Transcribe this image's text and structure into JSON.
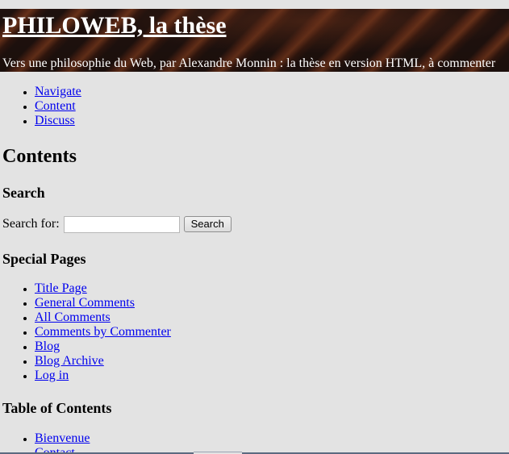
{
  "header": {
    "title": "PHILOWEB, la thèse",
    "tagline": "Vers une philosophie du Web, par Alexandre Monnin : la thèse en version HTML, à commenter"
  },
  "nav": {
    "items": [
      {
        "label": "Navigate"
      },
      {
        "label": "Content"
      },
      {
        "label": "Discuss"
      }
    ]
  },
  "main": {
    "heading": "Contents"
  },
  "search": {
    "heading": "Search",
    "label": "Search for:",
    "value": "",
    "placeholder": "",
    "button_label": "Search"
  },
  "special_pages": {
    "heading": "Special Pages",
    "items": [
      {
        "label": "Title Page"
      },
      {
        "label": "General Comments"
      },
      {
        "label": "All Comments"
      },
      {
        "label": "Comments by Commenter"
      },
      {
        "label": "Blog"
      },
      {
        "label": "Blog Archive"
      },
      {
        "label": "Log in"
      }
    ]
  },
  "toc": {
    "heading": "Table of Contents",
    "items": [
      {
        "label": "Bienvenue"
      },
      {
        "label": "Contact"
      }
    ]
  },
  "colors": {
    "background": "#e3e3e3",
    "link": "#0000ee",
    "header_text": "#ffffff",
    "header_bg": "#2a1812"
  }
}
